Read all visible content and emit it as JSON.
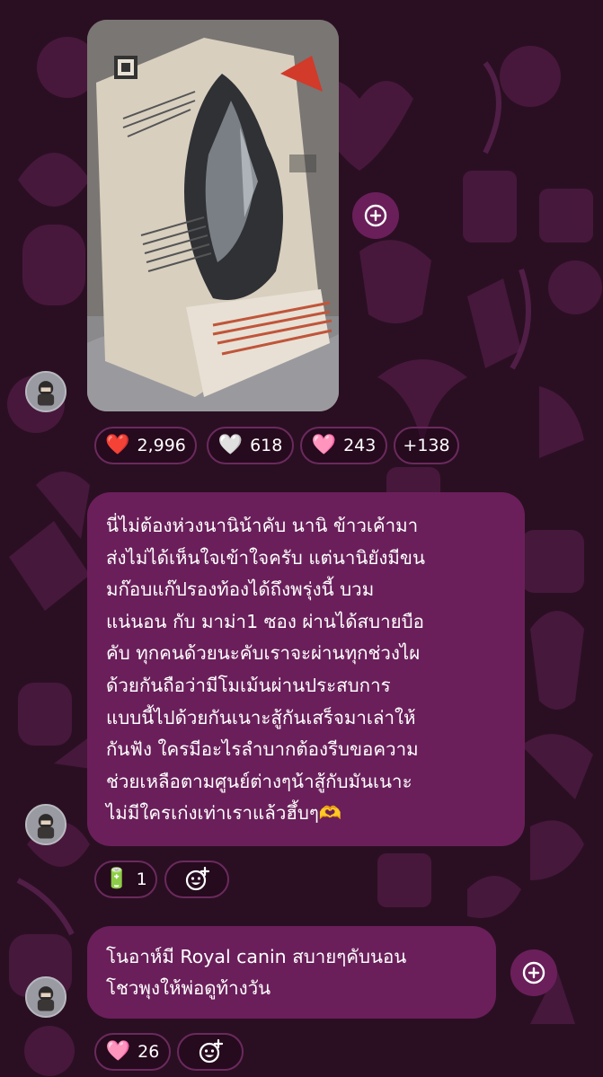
{
  "post": {
    "photo_alt": "package photo",
    "reactions": [
      {
        "icon": "❤️",
        "count": "2,996"
      },
      {
        "icon": "🤍",
        "count": "618"
      },
      {
        "icon": "🩷",
        "count": "243"
      }
    ],
    "more_reactions": "+138"
  },
  "message1": {
    "text": "นี่ไม่ต้องห่วงนานิน้าคับ นานิ ข้าวเค้ามา\nส่งไม่ได้เห็นใจเข้าใจครับ แต่นานิยังมีขน\nมก๊อบแก๊ปรองท้องได้ถึงพรุ่งนี้ บวม\nแน่นอน กับ มาม่า1 ซอง ผ่านได้สบายบือ\nคับ ทุกคนด้วยนะคับเราจะผ่านทุกช่วงไผ\nด้วยกันถือว่ามีโมเม้นผ่านประสบการ\nแบบนี้ไปด้วยกันเนาะสู้กันเสร็จมาเล่าให้\nกันฟัง ใครมีอะไรลำบากต้องรีบขอความ\nช่วยเหลือตามศูนย์ต่างๆน้าสู้กับมันเนาะ\nไม่มีใครเก่งเท่าเราแล้วฮึ้บๆ🫶",
    "reaction": {
      "icon": "🔋",
      "count": "1"
    }
  },
  "message2": {
    "text": "โนอาห์มี Royal canin สบายๆคับนอน\nโชวพุงให้พ่อดูท้างวัน",
    "reaction": {
      "icon": "🩷",
      "count": "26"
    }
  }
}
